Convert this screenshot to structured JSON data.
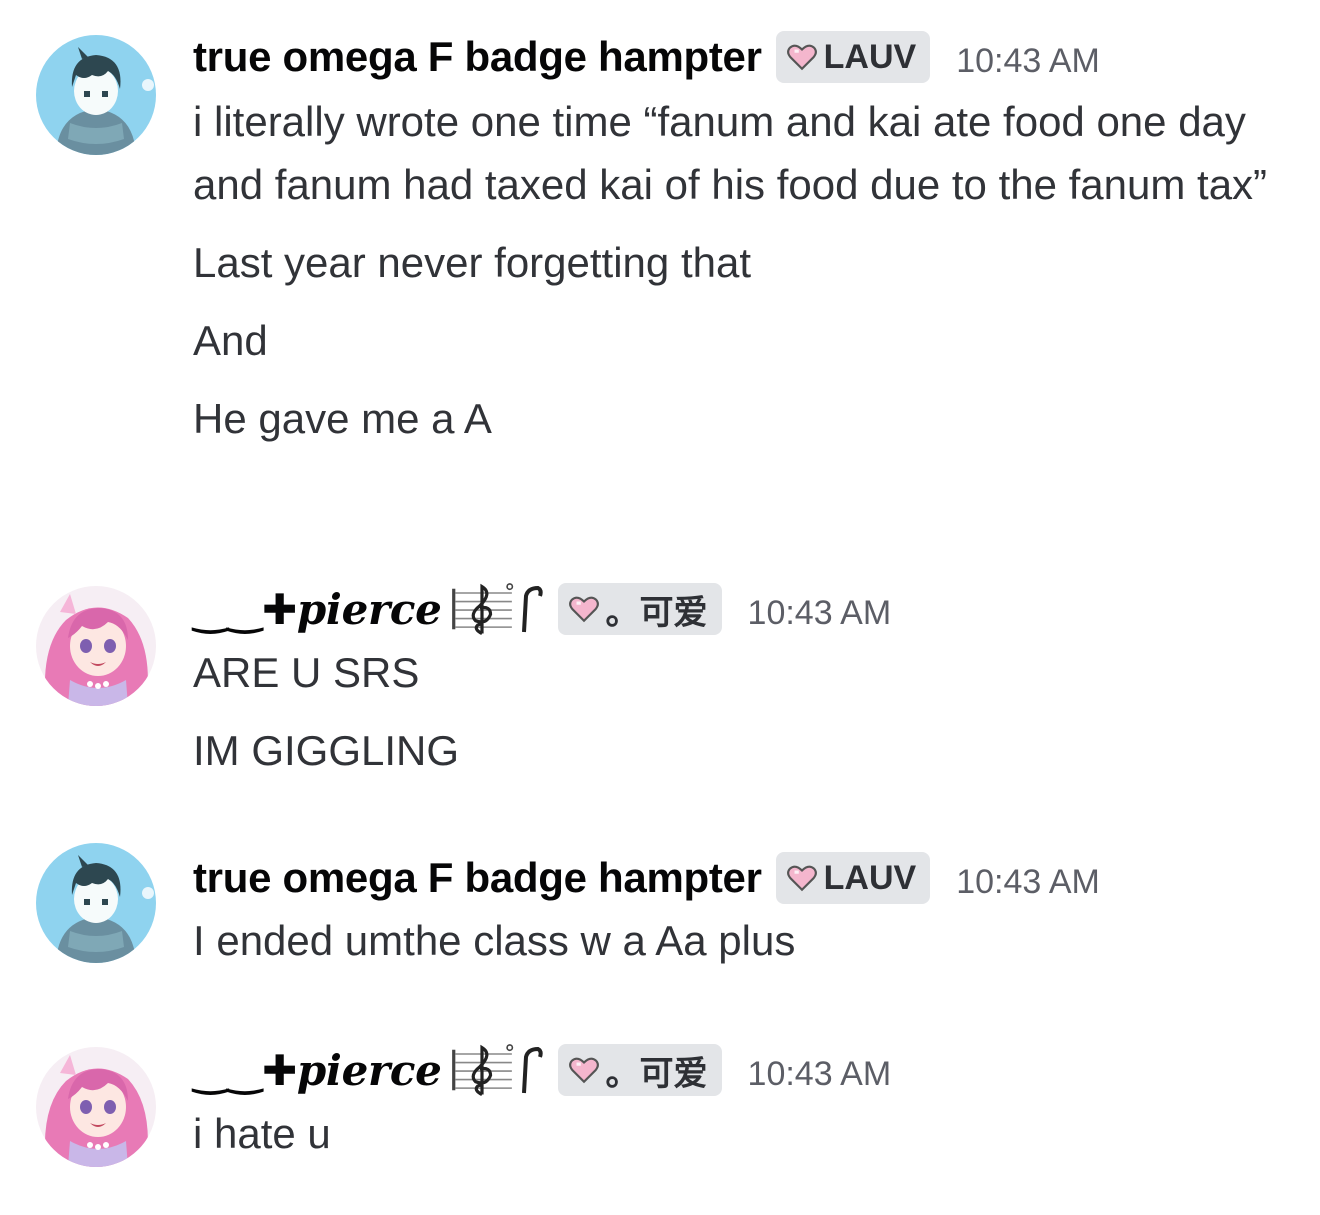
{
  "groups": [
    {
      "author": {
        "name": "true omega F badge hampter",
        "avatar": "boy-avatar"
      },
      "role_tag": {
        "icon": "pink-heart-icon",
        "label": "LAUV"
      },
      "timestamp": "10:43 AM",
      "messages": [
        "i literally wrote one time “fanum and kai ate food one day and fanum had taxed kai of his food due to the fanum tax”",
        "Last year never forgetting that",
        "And",
        "He gave me a A"
      ]
    },
    {
      "author": {
        "prefix": "‿‿✚",
        "name": "pierce",
        "avatar": "pink-hair-girl-avatar",
        "decorations": [
          "treble-clef-icon",
          "music-note-icon"
        ]
      },
      "role_tag": {
        "icon": "pink-heart-icon",
        "label": "。可爱"
      },
      "timestamp": "10:43 AM",
      "messages": [
        "ARE U SRS",
        "IM GIGGLING"
      ]
    },
    {
      "author": {
        "name": "true omega F badge hampter",
        "avatar": "boy-avatar"
      },
      "role_tag": {
        "icon": "pink-heart-icon",
        "label": "LAUV"
      },
      "timestamp": "10:43 AM",
      "messages": [
        "I ended umthe class w a Aa plus"
      ]
    },
    {
      "author": {
        "prefix": "‿‿✚",
        "name": "pierce",
        "avatar": "pink-hair-girl-avatar",
        "decorations": [
          "treble-clef-icon",
          "music-note-icon"
        ]
      },
      "role_tag": {
        "icon": "pink-heart-icon",
        "label": "。可爱"
      },
      "timestamp": "10:43 AM",
      "messages": [
        "i hate u"
      ]
    }
  ]
}
